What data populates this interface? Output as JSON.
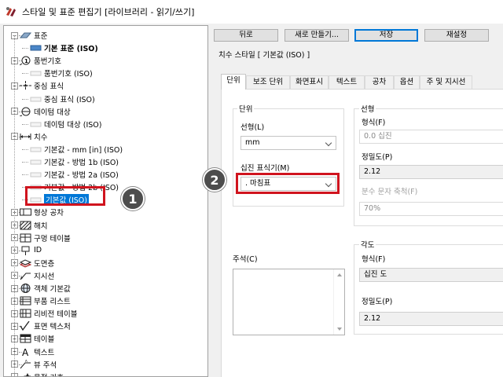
{
  "window": {
    "title": "스타일 및 표준 편집기 [라이브러리 - 읽기/쓰기]"
  },
  "tree": {
    "items": [
      {
        "label": "표준",
        "level": 0,
        "expander": "−",
        "icon": "standard-icon"
      },
      {
        "label": "기본 표준 (ISO)",
        "level": 1,
        "icon": "standard-doc-icon",
        "bold": true
      },
      {
        "label": "품번기호",
        "level": 0,
        "expander": "−",
        "icon": "balloon-icon"
      },
      {
        "label": "품번기호 (ISO)",
        "level": 1,
        "icon": "style-item-icon"
      },
      {
        "label": "중심 표식",
        "level": 0,
        "expander": "−",
        "icon": "center-mark-icon"
      },
      {
        "label": "중심 표식 (ISO)",
        "level": 1,
        "icon": "style-item-icon"
      },
      {
        "label": "데이텀 대상",
        "level": 0,
        "expander": "−",
        "icon": "datum-target-icon"
      },
      {
        "label": "데이텀 대상 (ISO)",
        "level": 1,
        "icon": "style-item-icon"
      },
      {
        "label": "치수",
        "level": 0,
        "expander": "−",
        "icon": "dimension-icon"
      },
      {
        "label": "기본값 - mm [in] (ISO)",
        "level": 1,
        "icon": "style-item-icon"
      },
      {
        "label": "기본값 - 방법 1b (ISO)",
        "level": 1,
        "icon": "style-item-icon"
      },
      {
        "label": "기본값 - 방법 2a (ISO)",
        "level": 1,
        "icon": "style-item-icon"
      },
      {
        "label": "기본값 - 방법 2b (ISO)",
        "level": 1,
        "icon": "style-item-icon"
      },
      {
        "label": "기본값 (ISO)",
        "level": 1,
        "icon": "style-item-icon",
        "selected": true
      },
      {
        "label": "형상 공차",
        "level": 0,
        "expander": "+",
        "icon": "feature-control-icon"
      },
      {
        "label": "해치",
        "level": 0,
        "expander": "+",
        "icon": "hatch-icon"
      },
      {
        "label": "구멍 테이블",
        "level": 0,
        "expander": "+",
        "icon": "hole-table-icon"
      },
      {
        "label": "ID",
        "level": 0,
        "expander": "+",
        "icon": "id-icon"
      },
      {
        "label": "도면층",
        "level": 0,
        "expander": "+",
        "icon": "layers-icon"
      },
      {
        "label": "지시선",
        "level": 0,
        "expander": "+",
        "icon": "leader-icon"
      },
      {
        "label": "객체 기본값",
        "level": 0,
        "expander": "+",
        "icon": "object-defaults-icon"
      },
      {
        "label": "부품 리스트",
        "level": 0,
        "expander": "+",
        "icon": "parts-list-icon"
      },
      {
        "label": "리비전 테이블",
        "level": 0,
        "expander": "+",
        "icon": "revision-table-icon"
      },
      {
        "label": "표면 텍스처",
        "level": 0,
        "expander": "+",
        "icon": "surface-texture-icon"
      },
      {
        "label": "테이블",
        "level": 0,
        "expander": "+",
        "icon": "table-icon"
      },
      {
        "label": "텍스트",
        "level": 0,
        "expander": "+",
        "icon": "text-icon"
      },
      {
        "label": "뷰 주석",
        "level": 0,
        "expander": "+",
        "icon": "view-annotation-icon"
      },
      {
        "label": "용접 기호",
        "level": 0,
        "expander": "+",
        "icon": "weld-symbol-icon"
      }
    ]
  },
  "toolbar": {
    "back": "뒤로",
    "new": "새로 만들기...",
    "save": "저장",
    "reset": "재설정"
  },
  "section": {
    "title": "치수 스타일 [ 기본값 (ISO) ]"
  },
  "tabs": [
    {
      "label": "단위",
      "active": true
    },
    {
      "label": "보조 단위"
    },
    {
      "label": "화면표시"
    },
    {
      "label": "텍스트"
    },
    {
      "label": "공차"
    },
    {
      "label": "옵션"
    },
    {
      "label": "주 및 지시선"
    }
  ],
  "units_group": {
    "label": "단위",
    "linear_label": "선형(L)",
    "linear_value": "mm",
    "decimal_marker_label": "십진 표식기(M)",
    "decimal_marker_value": ". 마침표"
  },
  "linear_group": {
    "label": "선형",
    "format_label": "형식(F)",
    "format_value": "0.0 십진",
    "precision_label": "정밀도(P)",
    "precision_value": "2.12",
    "fractional_label": "분수 문자 축척(F)",
    "fractional_value": "70%"
  },
  "comment": {
    "label": "주석(C)"
  },
  "angular_group": {
    "label": "각도",
    "format_label": "형식(F)",
    "format_value": "십진 도",
    "precision_label": "정밀도(P)",
    "precision_value": "2.12"
  },
  "callouts": {
    "one": "1",
    "two": "2"
  },
  "colors": {
    "highlight": "#d0141e",
    "selection": "#0078d7",
    "callout": "#4d4d4d"
  }
}
